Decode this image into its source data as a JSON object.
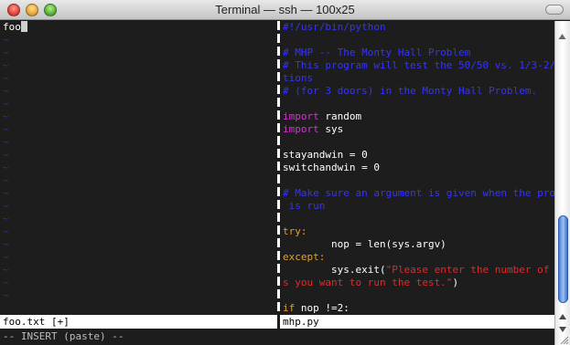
{
  "window": {
    "title": "Terminal — ssh — 100x25"
  },
  "left_pane": {
    "first_line": "foo",
    "tilde_count": 21,
    "tilde": "~"
  },
  "right_pane": {
    "lines": [
      [
        {
          "t": "#!/usr/bin/python",
          "c": "c-comment"
        }
      ],
      [],
      [
        {
          "t": "# MHP -- The Monty Hall Problem",
          "c": "c-comment"
        }
      ],
      [
        {
          "t": "# This program will test the 50/50 vs. 1/3-2/3 op",
          "c": "c-comment"
        }
      ],
      [
        {
          "t": "tions",
          "c": "c-comment"
        }
      ],
      [
        {
          "t": "# (for 3 doors) in the Monty Hall Problem.",
          "c": "c-comment"
        }
      ],
      [],
      [
        {
          "t": "import",
          "c": "c-keyword"
        },
        {
          "t": " random",
          "c": "c-text"
        }
      ],
      [
        {
          "t": "import",
          "c": "c-keyword"
        },
        {
          "t": " sys",
          "c": "c-text"
        }
      ],
      [],
      [
        {
          "t": "stayandwin = 0",
          "c": "c-text"
        }
      ],
      [
        {
          "t": "switchandwin = 0",
          "c": "c-text"
        }
      ],
      [],
      [
        {
          "t": "# Make sure an argument is given when the program",
          "c": "c-comment"
        }
      ],
      [
        {
          "t": " is run",
          "c": "c-comment"
        }
      ],
      [],
      [
        {
          "t": "try:",
          "c": "c-orange"
        }
      ],
      [
        {
          "t": "        nop = len(sys.argv)",
          "c": "c-text"
        }
      ],
      [
        {
          "t": "except:",
          "c": "c-orange"
        }
      ],
      [
        {
          "t": "        sys.exit(",
          "c": "c-text"
        },
        {
          "t": "\"Please enter the number of time",
          "c": "c-string"
        }
      ],
      [
        {
          "t": "s you want to run the test.\"",
          "c": "c-string"
        },
        {
          "t": ")",
          "c": "c-text"
        }
      ],
      [],
      [
        {
          "t": "if",
          "c": "c-orange"
        },
        {
          "t": " nop !=2:",
          "c": "c-text"
        }
      ]
    ]
  },
  "status": {
    "left_file": "foo.txt [+]",
    "right_file": "mhp.py",
    "mode": "-- INSERT (paste) --"
  }
}
